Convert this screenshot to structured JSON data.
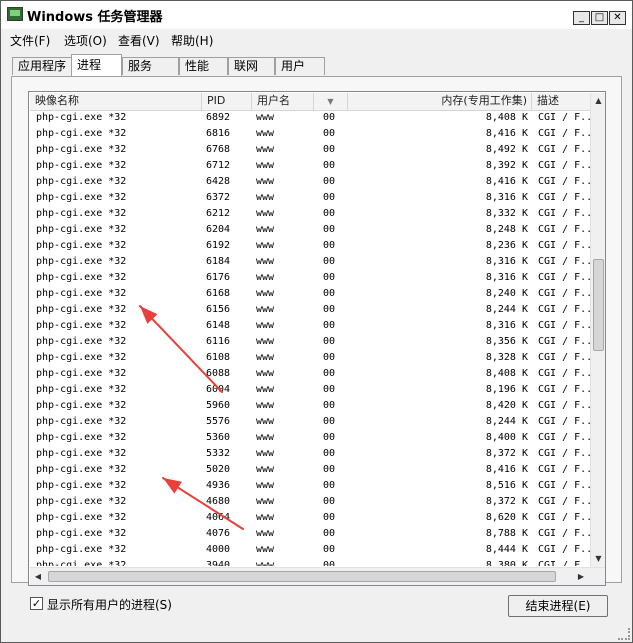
{
  "window": {
    "title": "Windows 任务管理器",
    "min_glyph": "_",
    "max_glyph": "□",
    "close_glyph": "✕"
  },
  "menu": [
    "文件(F)",
    "选项(O)",
    "查看(V)",
    "帮助(H)"
  ],
  "tabs": [
    "应用程序",
    "进程",
    "服务",
    "性能",
    "联网",
    "用户"
  ],
  "active_tab": "进程",
  "columns": {
    "name": "映像名称",
    "pid": "PID",
    "user": "用户名",
    "cpu": "",
    "memory": "内存(专用工作集)",
    "desc": "描述"
  },
  "processes": [
    {
      "name": "php-cgi.exe *32",
      "pid": "6892",
      "user": "www",
      "cpu": "00",
      "memory": "8,408 K",
      "desc": "CGI / F..."
    },
    {
      "name": "php-cgi.exe *32",
      "pid": "6816",
      "user": "www",
      "cpu": "00",
      "memory": "8,416 K",
      "desc": "CGI / F..."
    },
    {
      "name": "php-cgi.exe *32",
      "pid": "6768",
      "user": "www",
      "cpu": "00",
      "memory": "8,492 K",
      "desc": "CGI / F..."
    },
    {
      "name": "php-cgi.exe *32",
      "pid": "6712",
      "user": "www",
      "cpu": "00",
      "memory": "8,392 K",
      "desc": "CGI / F..."
    },
    {
      "name": "php-cgi.exe *32",
      "pid": "6428",
      "user": "www",
      "cpu": "00",
      "memory": "8,416 K",
      "desc": "CGI / F..."
    },
    {
      "name": "php-cgi.exe *32",
      "pid": "6372",
      "user": "www",
      "cpu": "00",
      "memory": "8,316 K",
      "desc": "CGI / F..."
    },
    {
      "name": "php-cgi.exe *32",
      "pid": "6212",
      "user": "www",
      "cpu": "00",
      "memory": "8,332 K",
      "desc": "CGI / F..."
    },
    {
      "name": "php-cgi.exe *32",
      "pid": "6204",
      "user": "www",
      "cpu": "00",
      "memory": "8,248 K",
      "desc": "CGI / F..."
    },
    {
      "name": "php-cgi.exe *32",
      "pid": "6192",
      "user": "www",
      "cpu": "00",
      "memory": "8,236 K",
      "desc": "CGI / F..."
    },
    {
      "name": "php-cgi.exe *32",
      "pid": "6184",
      "user": "www",
      "cpu": "00",
      "memory": "8,316 K",
      "desc": "CGI / F..."
    },
    {
      "name": "php-cgi.exe *32",
      "pid": "6176",
      "user": "www",
      "cpu": "00",
      "memory": "8,316 K",
      "desc": "CGI / F..."
    },
    {
      "name": "php-cgi.exe *32",
      "pid": "6168",
      "user": "www",
      "cpu": "00",
      "memory": "8,240 K",
      "desc": "CGI / F..."
    },
    {
      "name": "php-cgi.exe *32",
      "pid": "6156",
      "user": "www",
      "cpu": "00",
      "memory": "8,244 K",
      "desc": "CGI / F..."
    },
    {
      "name": "php-cgi.exe *32",
      "pid": "6148",
      "user": "www",
      "cpu": "00",
      "memory": "8,316 K",
      "desc": "CGI / F..."
    },
    {
      "name": "php-cgi.exe *32",
      "pid": "6116",
      "user": "www",
      "cpu": "00",
      "memory": "8,356 K",
      "desc": "CGI / F..."
    },
    {
      "name": "php-cgi.exe *32",
      "pid": "6108",
      "user": "www",
      "cpu": "00",
      "memory": "8,328 K",
      "desc": "CGI / F..."
    },
    {
      "name": "php-cgi.exe *32",
      "pid": "6088",
      "user": "www",
      "cpu": "00",
      "memory": "8,408 K",
      "desc": "CGI / F..."
    },
    {
      "name": "php-cgi.exe *32",
      "pid": "6004",
      "user": "www",
      "cpu": "00",
      "memory": "8,196 K",
      "desc": "CGI / F..."
    },
    {
      "name": "php-cgi.exe *32",
      "pid": "5960",
      "user": "www",
      "cpu": "00",
      "memory": "8,420 K",
      "desc": "CGI / F..."
    },
    {
      "name": "php-cgi.exe *32",
      "pid": "5576",
      "user": "www",
      "cpu": "00",
      "memory": "8,244 K",
      "desc": "CGI / F..."
    },
    {
      "name": "php-cgi.exe *32",
      "pid": "5360",
      "user": "www",
      "cpu": "00",
      "memory": "8,400 K",
      "desc": "CGI / F..."
    },
    {
      "name": "php-cgi.exe *32",
      "pid": "5332",
      "user": "www",
      "cpu": "00",
      "memory": "8,372 K",
      "desc": "CGI / F..."
    },
    {
      "name": "php-cgi.exe *32",
      "pid": "5020",
      "user": "www",
      "cpu": "00",
      "memory": "8,416 K",
      "desc": "CGI / F..."
    },
    {
      "name": "php-cgi.exe *32",
      "pid": "4936",
      "user": "www",
      "cpu": "00",
      "memory": "8,516 K",
      "desc": "CGI / F..."
    },
    {
      "name": "php-cgi.exe *32",
      "pid": "4680",
      "user": "www",
      "cpu": "00",
      "memory": "8,372 K",
      "desc": "CGI / F..."
    },
    {
      "name": "php-cgi.exe *32",
      "pid": "4064",
      "user": "www",
      "cpu": "00",
      "memory": "8,620 K",
      "desc": "CGI / F..."
    },
    {
      "name": "php-cgi.exe *32",
      "pid": "4076",
      "user": "www",
      "cpu": "00",
      "memory": "8,788 K",
      "desc": "CGI / F..."
    },
    {
      "name": "php-cgi.exe *32",
      "pid": "4000",
      "user": "www",
      "cpu": "00",
      "memory": "8,444 K",
      "desc": "CGI / F..."
    },
    {
      "name": "php-cgi.exe *32",
      "pid": "3940",
      "user": "www",
      "cpu": "00",
      "memory": "8,380 K",
      "desc": "CGI / F..."
    }
  ],
  "show_all_users": {
    "label": "显示所有用户的进程(S)",
    "checked_glyph": "✓"
  },
  "end_process_label": "结束进程(E)",
  "annotation_color": "#e8403a"
}
